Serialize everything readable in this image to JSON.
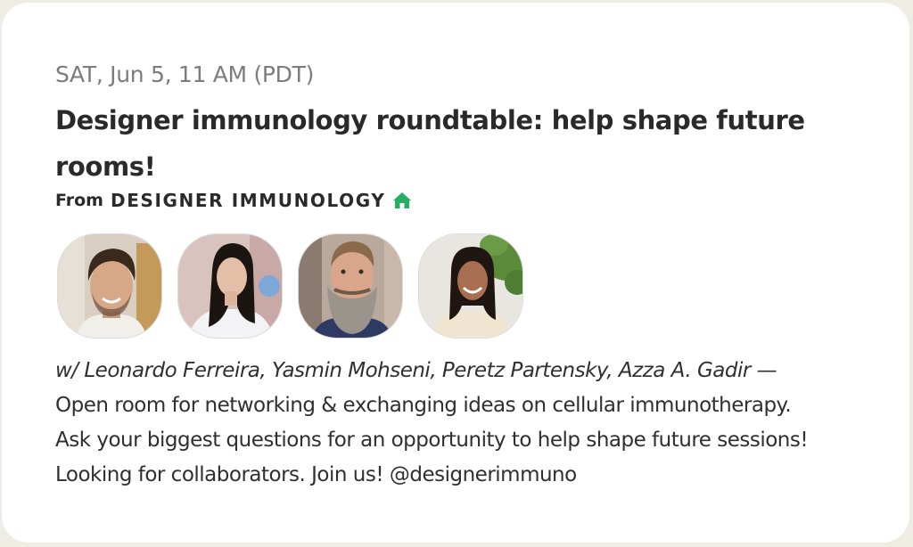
{
  "event": {
    "datetime": "SAT, Jun 5, 11 AM (PDT)",
    "title": "Designer immunology roundtable: help shape future rooms!",
    "from_label": "From",
    "club_name": "DESIGNER IMMUNOLOGY",
    "club_icon": "house-icon",
    "accent_color": "#27ae60",
    "speakers_line": "w/ Leonardo Ferreira, Yasmin Mohseni, Peretz Partensky, Azza A. Gadir —",
    "description_lines": [
      "Open room for networking & exchanging ideas on cellular immunotherapy.",
      "Ask your biggest questions for an opportunity to help shape future sessions!",
      "Looking for collaborators. Join us! @designerimmuno"
    ]
  }
}
